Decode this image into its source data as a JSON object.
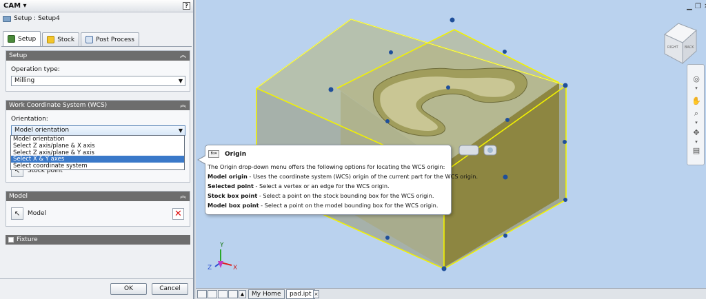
{
  "panel": {
    "title": "CAM",
    "help_label": "?",
    "breadcrumb": "Setup : Setup4",
    "tabs": [
      {
        "label": "Setup"
      },
      {
        "label": "Stock"
      },
      {
        "label": "Post Process"
      }
    ]
  },
  "setup_group": {
    "title": "Setup",
    "operation_type_label": "Operation type:",
    "operation_type_value": "Milling"
  },
  "wcs_group": {
    "title": "Work Coordinate System (WCS)",
    "orientation_label": "Orientation:",
    "orientation_value": "Model orientation",
    "options": [
      "Model orientation",
      "Select Z axis/plane & X axis",
      "Select Z axis/plane & Y axis",
      "Select X & Y axes",
      "Select coordinate system"
    ],
    "selected_index": 3,
    "origin_button_label": "Stock point"
  },
  "model_group": {
    "title": "Model",
    "model_button_label": "Model"
  },
  "fixture_group": {
    "title": "Fixture"
  },
  "dialog_buttons": {
    "ok": "OK",
    "cancel": "Cancel"
  },
  "tooltip": {
    "icon_text": "Bx▾",
    "title": "Origin",
    "intro": "The Origin drop-down menu offers the following options for locating the WCS origin:",
    "items": [
      {
        "term": "Model origin",
        "desc": " - Uses the coordinate system (WCS) origin of the current part for the WCS origin."
      },
      {
        "term": "Selected point",
        "desc": " - Select a vertex or an edge for the WCS origin."
      },
      {
        "term": "Stock box point",
        "desc": " - Select a point on the stock bounding box for the WCS origin."
      },
      {
        "term": "Model box point",
        "desc": " - Select a point on the model bounding box for the WCS origin."
      }
    ]
  },
  "viewcube": {
    "faces": [
      "RIGHT",
      "BACK"
    ]
  },
  "triad": {
    "x": "X",
    "y": "Y",
    "z": "Z"
  },
  "bottom_tabs": [
    {
      "label": "My Home"
    },
    {
      "label": "pad.ipt"
    }
  ],
  "colors": {
    "viewport_bg": "#bad2ee",
    "group_header": "#6d6d6d",
    "selection": "#3a79c9",
    "part_olive": "#9a9a48",
    "edge_yellow": "#f2f200",
    "handle_blue": "#1f4f9a"
  }
}
